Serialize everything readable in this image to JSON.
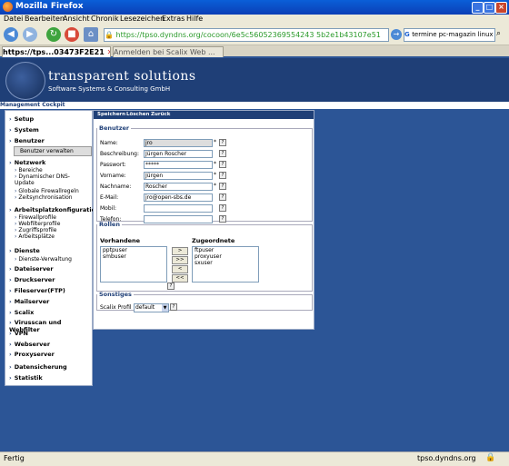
{
  "window": {
    "title": "Mozilla Firefox"
  },
  "menu": [
    "Datei",
    "Bearbeiten",
    "Ansicht",
    "Chronik",
    "Lesezeichen",
    "Extras",
    "Hilfe"
  ],
  "nav": {
    "url": "https://tpso.dyndns.org/cocoon/6e5c56052369554243 5b2e1b43107e51",
    "search_value": "termine pc-magazin linux"
  },
  "tabs": [
    {
      "label": "https://tps...03473F2E21",
      "active": true
    },
    {
      "label": "Anmelden bei Scalix Web ...",
      "active": false
    }
  ],
  "brand": {
    "title": "transparent solutions",
    "subtitle": "Software Systems & Consulting GmbH",
    "cockpit": "Management Cockpit"
  },
  "sidebar": {
    "items": [
      {
        "label": "Setup",
        "type": "main"
      },
      {
        "label": "System",
        "type": "main"
      },
      {
        "label": "Benutzer",
        "type": "main"
      },
      {
        "label": "Benutzer verwalten",
        "type": "active"
      },
      {
        "label": "Netzwerk",
        "type": "main"
      },
      {
        "label": "Bereiche",
        "type": "sub"
      },
      {
        "label": "Dynamischer DNS-Update",
        "type": "sub"
      },
      {
        "label": "Globale Firewallregeln",
        "type": "sub"
      },
      {
        "label": "Zeitsynchronisation",
        "type": "sub"
      },
      {
        "label": "Arbeitsplatzkonfiguration",
        "type": "main"
      },
      {
        "label": "Firewallprofile",
        "type": "sub"
      },
      {
        "label": "Webfilterprofile",
        "type": "sub"
      },
      {
        "label": "Zugriffsprofile",
        "type": "sub"
      },
      {
        "label": "Arbeitsplätze",
        "type": "sub"
      },
      {
        "label": "Dienste",
        "type": "main"
      },
      {
        "label": "Dienste-Verwaltung",
        "type": "sub"
      },
      {
        "label": "Dateiserver",
        "type": "main"
      },
      {
        "label": "Druckserver",
        "type": "main"
      },
      {
        "label": "Fileserver(FTP)",
        "type": "main"
      },
      {
        "label": "Mailserver",
        "type": "main"
      },
      {
        "label": "Scalix",
        "type": "main"
      },
      {
        "label": "Virusscan und Webfilter",
        "type": "main"
      },
      {
        "label": "VPN",
        "type": "main"
      },
      {
        "label": "Webserver",
        "type": "main"
      },
      {
        "label": "Proxyserver",
        "type": "main"
      },
      {
        "label": "Datensicherung",
        "type": "main"
      },
      {
        "label": "Statistik",
        "type": "main"
      }
    ]
  },
  "toolbar": {
    "save": "Speichern",
    "delete": "Löschen",
    "back": "Zurück"
  },
  "user_form": {
    "legend": "Benutzer",
    "fields": [
      {
        "label": "Name:",
        "value": "jro",
        "required": true
      },
      {
        "label": "Beschreibung:",
        "value": "Jürgen Roscher",
        "required": false
      },
      {
        "label": "Passwort:",
        "value": "*****",
        "required": true
      },
      {
        "label": "Vorname:",
        "value": "Jürgen",
        "required": true
      },
      {
        "label": "Nachname:",
        "value": "Roscher",
        "required": true
      },
      {
        "label": "E-Mail:",
        "value": "jro@open-sbs.de",
        "required": false
      },
      {
        "label": "Mobil:",
        "value": "",
        "required": false
      },
      {
        "label": "Telefon:",
        "value": "",
        "required": false
      }
    ]
  },
  "roles": {
    "legend": "Rollen",
    "available_label": "Vorhandene",
    "assigned_label": "Zugeordnete",
    "available": [
      "pptpuser",
      "smbuser"
    ],
    "assigned": [
      "ftpuser",
      "proxyuser",
      "sxuser"
    ],
    "buttons": [
      ">",
      ">>",
      "<",
      "<<"
    ]
  },
  "other": {
    "legend": "Sonstiges",
    "profile_label": "Scalix Profil",
    "profile_value": "default"
  },
  "status": {
    "left": "Fertig",
    "right": "tpso.dyndns.org"
  }
}
